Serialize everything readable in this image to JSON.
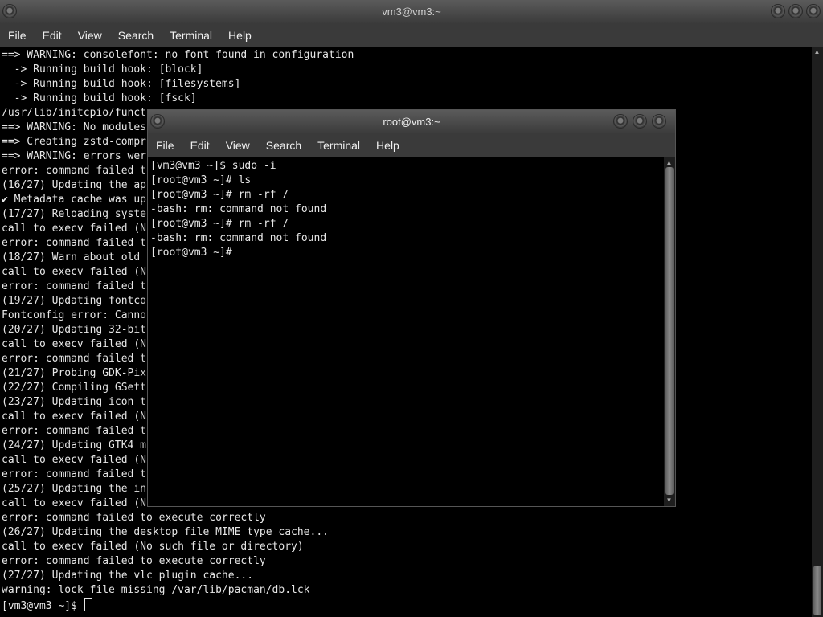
{
  "back_window": {
    "title": "vm3@vm3:~",
    "menu": [
      "File",
      "Edit",
      "View",
      "Search",
      "Terminal",
      "Help"
    ],
    "lines": [
      "==> WARNING: consolefont: no font found in configuration",
      "  -> Running build hook: [block]",
      "  -> Running build hook: [filesystems]",
      "  -> Running build hook: [fsck]",
      "/usr/lib/initcpio/funct",
      "==> WARNING: No modules",
      "==> Creating zstd-compr",
      "==> WARNING: errors wer",
      "error: command failed t",
      "(16/27) Updating the ap",
      "✔ Metadata cache was up",
      "(17/27) Reloading syste",
      "call to execv failed (N",
      "error: command failed t",
      "(18/27) Warn about old",
      "call to execv failed (N",
      "error: command failed t",
      "(19/27) Updating fontco",
      "Fontconfig error: Canno",
      "(20/27) Updating 32-bit",
      "call to execv failed (N",
      "error: command failed t",
      "(21/27) Probing GDK-Pix",
      "(22/27) Compiling GSett",
      "(23/27) Updating icon t",
      "call to execv failed (N",
      "error: command failed t",
      "(24/27) Updating GTK4 m",
      "call to execv failed (N",
      "error: command failed t",
      "(25/27) Updating the in",
      "call to execv failed (N",
      "error: command failed to execute correctly",
      "(26/27) Updating the desktop file MIME type cache...",
      "call to execv failed (No such file or directory)",
      "error: command failed to execute correctly",
      "(27/27) Updating the vlc plugin cache...",
      "warning: lock file missing /var/lib/pacman/db.lck",
      "[vm3@vm3 ~]$ "
    ]
  },
  "front_window": {
    "title": "root@vm3:~",
    "menu": [
      "File",
      "Edit",
      "View",
      "Search",
      "Terminal",
      "Help"
    ],
    "lines": [
      "[vm3@vm3 ~]$ sudo -i",
      "[root@vm3 ~]# ls",
      "[root@vm3 ~]# rm -rf /",
      "-bash: rm: command not found",
      "[root@vm3 ~]# rm -rf /",
      "-bash: rm: command not found",
      "[root@vm3 ~]#"
    ]
  }
}
